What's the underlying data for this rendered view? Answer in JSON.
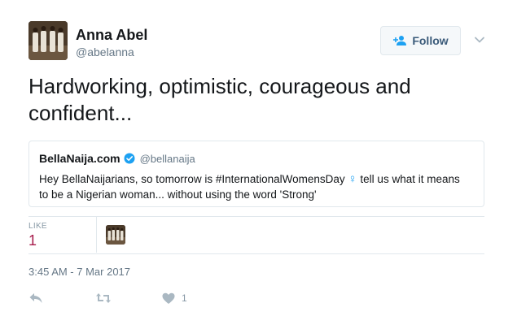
{
  "author": {
    "name": "Anna Abel",
    "handle": "@abelanna",
    "avatar_icon": "profile-photo"
  },
  "follow_button": {
    "label": "Follow",
    "icon": "add-user-icon"
  },
  "tweet": {
    "text": "Hardworking, optimistic, courageous and confident..."
  },
  "quoted_tweet": {
    "name": "BellaNaija.com",
    "verified_icon": "verified-badge-icon",
    "handle": "@bellanaija",
    "text_before": "Hey BellaNaijarians, so tomorrow is #InternationalWomensDay ",
    "symbol": "♀",
    "text_after": " tell us what it means to be a Nigerian woman... without using the word 'Strong'"
  },
  "stats": {
    "like_label": "LIKE",
    "like_count": "1"
  },
  "timestamp": "3:45 AM - 7 Mar 2017",
  "actions": {
    "reply_icon": "reply-icon",
    "retweet_icon": "retweet-icon",
    "like_icon": "heart-icon",
    "like_count": "1"
  },
  "colors": {
    "accent": "#1da1f2",
    "like": "#a71b4b",
    "muted": "#657786",
    "border": "#e1e8ed"
  }
}
